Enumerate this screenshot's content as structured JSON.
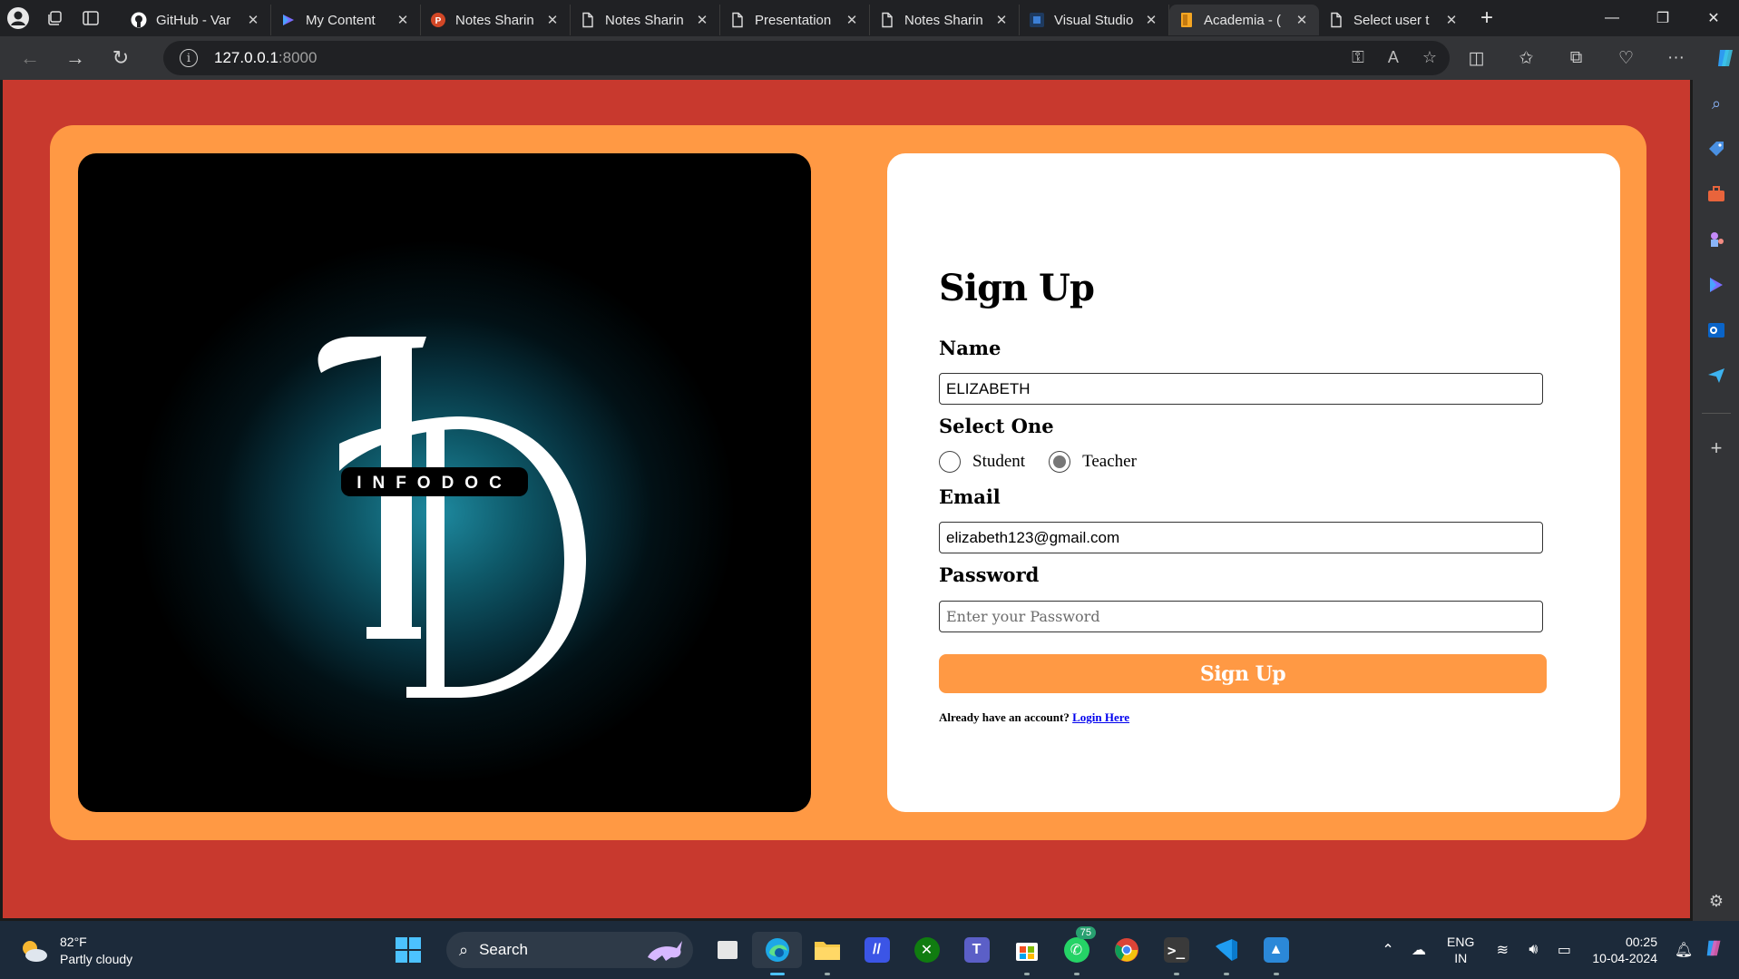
{
  "browser": {
    "tabs": [
      {
        "label": "GitHub - Var",
        "icon": "github-icon"
      },
      {
        "label": "My Content",
        "icon": "copilot-icon"
      },
      {
        "label": "Notes Sharin",
        "icon": "powerpoint-icon"
      },
      {
        "label": "Notes Sharin",
        "icon": "document-icon"
      },
      {
        "label": "Presentation",
        "icon": "document-icon"
      },
      {
        "label": "Notes Sharin",
        "icon": "document-icon"
      },
      {
        "label": "Visual Studio",
        "icon": "visual-studio-icon"
      },
      {
        "label": "Academia - (",
        "icon": "academia-icon",
        "active": true
      },
      {
        "label": "Select user t",
        "icon": "document-icon"
      }
    ],
    "url_host": "127.0.0.1",
    "url_port": ":8000"
  },
  "page": {
    "colors": {
      "background": "#c8392e",
      "card": "#ff9944",
      "panel": "#ffffff"
    },
    "logo": {
      "letters": "ID",
      "wordmark": "INFODOC"
    },
    "form": {
      "title": "Sign Up",
      "name_label": "Name",
      "name_value": "ELIZABETH",
      "select_label": "Select One",
      "role_options": [
        "Student",
        "Teacher"
      ],
      "role_selected": "Teacher",
      "email_label": "Email",
      "email_value": "elizabeth123@gmail.com",
      "password_label": "Password",
      "password_placeholder": "Enter your Password",
      "submit_label": "Sign Up",
      "login_prompt": "Already have an account?",
      "login_link": "Login Here"
    }
  },
  "taskbar": {
    "weather_temp": "82°F",
    "weather_desc": "Partly cloudy",
    "search_placeholder": "Search",
    "whatsapp_badge": "75",
    "lang_line1": "ENG",
    "lang_line2": "IN",
    "time": "00:25",
    "date": "10-04-2024"
  }
}
